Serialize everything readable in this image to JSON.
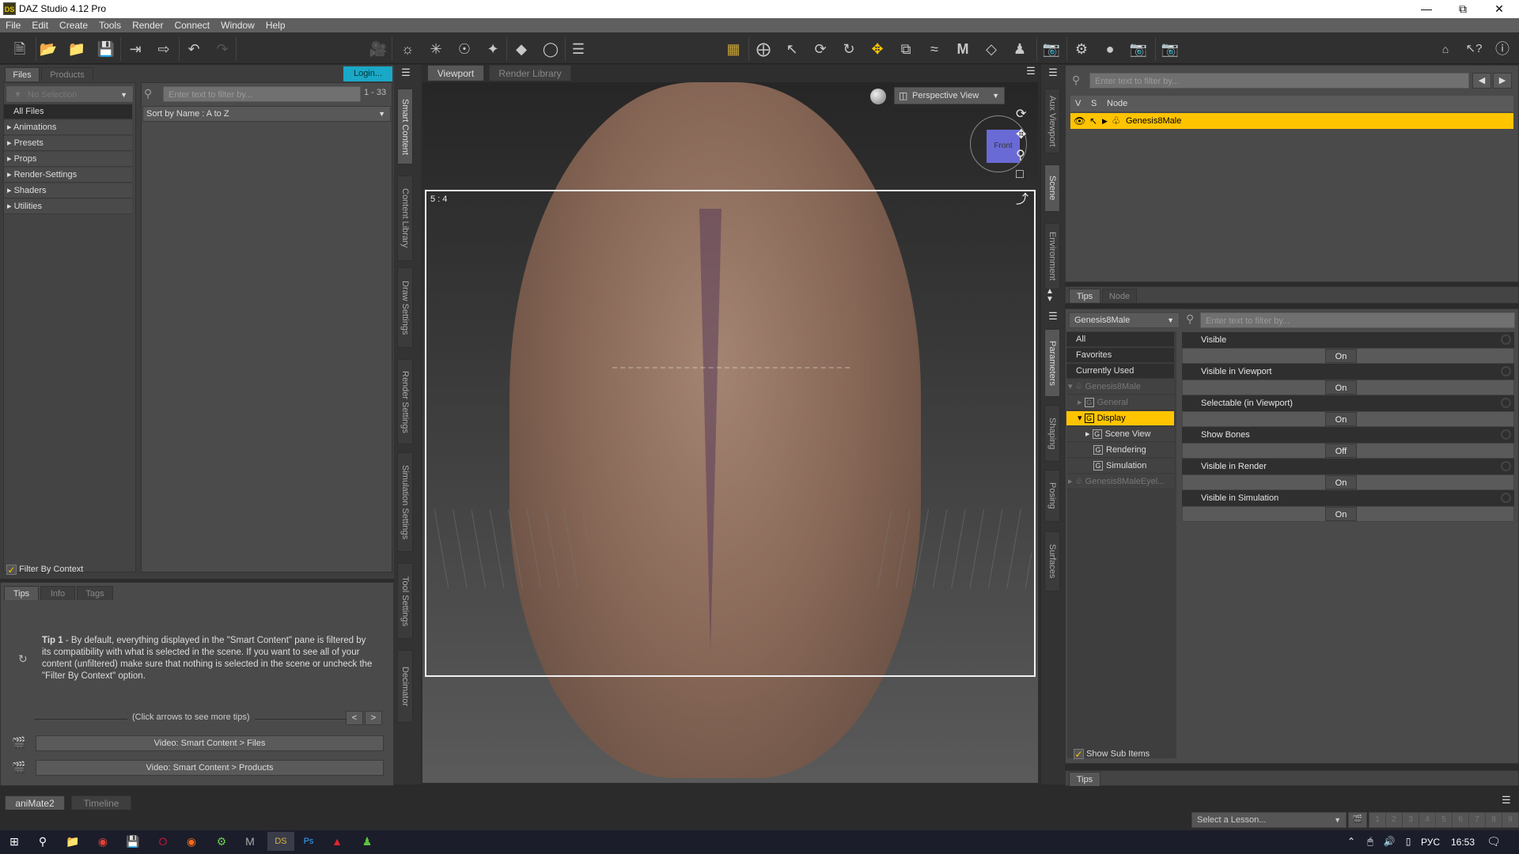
{
  "window": {
    "title": "DAZ Studio 4.12 Pro",
    "logo": "DS",
    "controls": [
      "minimize-icon",
      "restore-icon",
      "close-icon"
    ]
  },
  "menu": [
    "File",
    "Edit",
    "Create",
    "Tools",
    "Render",
    "Connect",
    "Window",
    "Help"
  ],
  "toolbar": {
    "file_tools": [
      "new-file-icon",
      "open-file-icon",
      "merge-file-icon",
      "save-icon",
      "import-icon",
      "export-icon",
      "undo-icon",
      "redo-icon"
    ],
    "create_tools": [
      "new-camera-icon",
      "new-distant-light-icon",
      "new-spotlight-icon",
      "new-point-light-icon",
      "new-linear-light-icon",
      "new-primitive-icon",
      "new-null-icon",
      "pane-layout-icon"
    ],
    "scene_tools": [
      "aniblock-icon",
      "universal-tool-icon",
      "node-selection-icon",
      "rotate-tool-icon",
      "twist-tool-icon",
      "translate-tool-icon",
      "scale-tool-icon",
      "joint-editor-icon",
      "geometry-editor-icon",
      "surface-selection-icon",
      "figure-setup-icon",
      "camera-tool-icon",
      "tool-settings-icon",
      "render-settings-icon",
      "render-camera-icon",
      "render-icon"
    ],
    "right_tools": [
      "daz-home-icon",
      "whats-this-icon",
      "help-icon"
    ]
  },
  "left_panel": {
    "tabs": [
      "Files",
      "Products"
    ],
    "login_label": "Login...",
    "selection_dropdown": "No Selection",
    "search_placeholder": "Enter text to filter by...",
    "count": "1 - 33",
    "sort_label": "Sort by Name : A to Z",
    "categories": [
      {
        "label": "All Files",
        "expandable": false
      },
      {
        "label": "Animations",
        "expandable": true
      },
      {
        "label": "Presets",
        "expandable": true
      },
      {
        "label": "Props",
        "expandable": true
      },
      {
        "label": "Render-Settings",
        "expandable": true
      },
      {
        "label": "Shaders",
        "expandable": true
      },
      {
        "label": "Utilities",
        "expandable": true
      }
    ],
    "filter_by_context": {
      "label": "Filter By Context",
      "checked": true
    },
    "vertical_tabs": [
      "Smart Content",
      "Content Library",
      "Draw Settings",
      "Render Settings",
      "Simulation Settings",
      "Tool Settings",
      "Decimator"
    ]
  },
  "tips_panel": {
    "tabs": [
      "Tips",
      "Info",
      "Tags"
    ],
    "tip_title": "Tip 1",
    "tip_text": " - By default, everything displayed in the \"Smart Content\" pane is filtered by its compatibility with what is selected in the scene. If you want to see all of your content (unfiltered) make sure that nothing is selected in the scene or uncheck the \"Filter By Context\" option.",
    "more_tips": "(Click arrows to see more tips)",
    "prev": "<",
    "next": ">",
    "video_buttons": [
      "Video: Smart Content > Files",
      "Video: Smart Content > Products"
    ]
  },
  "viewport": {
    "tabs": [
      "Viewport",
      "Render Library"
    ],
    "view_dropdown": "Perspective View",
    "aspect_label": "5 : 4",
    "cube_label": "Front",
    "nav_icons": [
      "orbit-icon",
      "pan-icon",
      "zoom-icon",
      "frame-icon",
      "reset-icon"
    ]
  },
  "scene_panel": {
    "search_placeholder": "Enter text to filter by...",
    "columns": [
      "V",
      "S",
      "Node"
    ],
    "nodes": [
      {
        "name": "Genesis8Male",
        "selected": true
      }
    ],
    "vertical_tabs": [
      "Aux Viewport",
      "Scene",
      "Environment"
    ],
    "lower_tabs": [
      "Tips",
      "Node"
    ]
  },
  "parameters_panel": {
    "node_dropdown": "Genesis8Male",
    "search_placeholder": "Enter text to filter by...",
    "tree": [
      {
        "label": "All",
        "level": 0,
        "type": "plain"
      },
      {
        "label": "Favorites",
        "level": 0,
        "type": "plain"
      },
      {
        "label": "Currently Used",
        "level": 0,
        "type": "plain"
      },
      {
        "label": "Genesis8Male",
        "level": 0,
        "type": "figure",
        "expanded": true,
        "dim": true
      },
      {
        "label": "General",
        "level": 1,
        "type": "group",
        "expanded": false,
        "dim": true
      },
      {
        "label": "Display",
        "level": 1,
        "type": "group",
        "expanded": true,
        "selected": true
      },
      {
        "label": "Scene View",
        "level": 2,
        "type": "group",
        "expanded": false
      },
      {
        "label": "Rendering",
        "level": 2,
        "type": "group"
      },
      {
        "label": "Simulation",
        "level": 2,
        "type": "group"
      },
      {
        "label": "Genesis8MaleEyel...",
        "level": 0,
        "type": "figure",
        "expanded": false,
        "dim": true
      }
    ],
    "params": [
      {
        "name": "Visible",
        "value": "On"
      },
      {
        "name": "Visible in Viewport",
        "value": "On"
      },
      {
        "name": "Selectable (in Viewport)",
        "value": "On"
      },
      {
        "name": "Show Bones",
        "value": "Off"
      },
      {
        "name": "Visible in Render",
        "value": "On"
      },
      {
        "name": "Visible in Simulation",
        "value": "On"
      }
    ],
    "show_sub_items": {
      "label": "Show Sub Items",
      "checked": true
    },
    "vertical_tabs": [
      "Parameters",
      "Shaping",
      "Posing",
      "Surfaces"
    ],
    "bottom_tab": "Tips"
  },
  "bottom": {
    "tabs": [
      "aniMate2",
      "Timeline"
    ],
    "lesson_placeholder": "Select a Lesson...",
    "lesson_steps": [
      "1",
      "2",
      "3",
      "4",
      "5",
      "6",
      "7",
      "8",
      "9"
    ]
  },
  "taskbar": {
    "apps": [
      "start-icon",
      "search-icon",
      "file-explorer-icon",
      "chrome-icon",
      "save-app-icon",
      "opera-icon",
      "firefox-icon",
      "green-app-icon",
      "m-app-icon",
      "daz-studio-icon",
      "photoshop-icon",
      "acrobat-icon",
      "green-people-icon"
    ],
    "language": "РУС",
    "time": "16:53"
  },
  "colors": {
    "accent": "#ffc400",
    "login": "#1aa8c8",
    "panel": "#454545",
    "dark": "#2b2b2b"
  }
}
